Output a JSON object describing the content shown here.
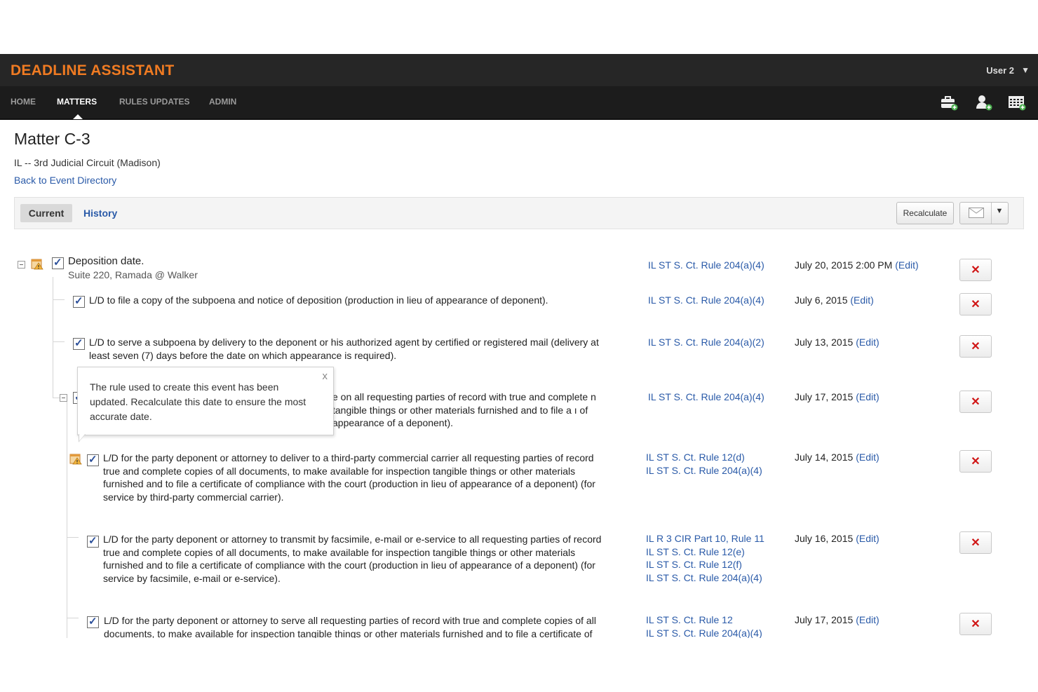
{
  "header": {
    "brand": "DEADLINE ASSISTANT",
    "user": "User 2",
    "nav": [
      "HOME",
      "MATTERS",
      "RULES UPDATES",
      "ADMIN"
    ],
    "tools": [
      "add-matter-icon",
      "add-user-icon",
      "add-calendar-icon"
    ]
  },
  "page": {
    "title": "Matter C-3",
    "court": "IL -- 3rd Judicial Circuit (Madison)",
    "back_link": "Back to Event Directory"
  },
  "tabs": {
    "current": "Current",
    "history": "History"
  },
  "toolbar": {
    "recalculate": "Recalculate"
  },
  "tooltip": {
    "text": "The rule used to create this event has been updated. Recalculate this date to ensure the most accurate date.",
    "close": "x"
  },
  "events": [
    {
      "title": "Deposition date.",
      "subtitle": "Suite 220, Ramada @ Walker",
      "rules": [
        "IL ST S. Ct. Rule 204(a)(4)"
      ],
      "date": "July 20, 2015 2:00 PM",
      "edit": "(Edit)"
    },
    {
      "text": "L/D to file a copy of the subpoena and notice of deposition (production in lieu of appearance of deponent).",
      "rules": [
        "IL ST S. Ct. Rule 204(a)(4)"
      ],
      "date": "July 6, 2015",
      "edit": "(Edit)"
    },
    {
      "text": "L/D to serve a subpoena by delivery to the deponent or his authorized agent by certified or registered mail (delivery at least seven (7) days before the date on which appearance is required).",
      "rules": [
        "IL ST S. Ct. Rule 204(a)(2)"
      ],
      "date": "July 13, 2015",
      "edit": "(Edit)"
    },
    {
      "text": "e on all requesting parties of record with true and complete n tangible things or other materials furnished and to file a ı of appearance of a deponent).",
      "rules": [
        "IL ST S. Ct. Rule 204(a)(4)"
      ],
      "date": "July 17, 2015",
      "edit": "(Edit)"
    },
    {
      "text": "L/D for the party deponent or attorney to deliver to a third-party commercial carrier all requesting parties of record true and complete copies of all documents, to make available for inspection tangible things or other materials furnished and to file a certificate of compliance with the court (production in lieu of appearance of a deponent) (for service by third-party commercial carrier).",
      "rules": [
        "IL ST S. Ct. Rule 12(d)",
        "IL ST S. Ct. Rule 204(a)(4)"
      ],
      "date": "July 14, 2015",
      "edit": "(Edit)"
    },
    {
      "text": "L/D for the party deponent or attorney to transmit by facsimile, e-mail or e-service to all requesting parties of record true and complete copies of all documents, to make available for inspection tangible things or other materials furnished and to file a certificate of compliance with the court (production in lieu of appearance of a deponent) (for service by facsimile, e-mail or e-service).",
      "rules": [
        "IL R 3 CIR Part 10, Rule 11",
        "IL ST S. Ct. Rule 12(e)",
        "IL ST S. Ct. Rule 12(f)",
        "IL ST S. Ct. Rule 204(a)(4)"
      ],
      "date": "July 16, 2015",
      "edit": "(Edit)"
    },
    {
      "text": "L/D for the party deponent or attorney to serve all requesting parties of record with true and complete copies of all documents, to make available for inspection tangible things or other materials furnished and to file a certificate of",
      "rules": [
        "IL ST S. Ct. Rule 12",
        "IL ST S. Ct. Rule 204(a)(4)"
      ],
      "date": "July 17, 2015",
      "edit": "(Edit)"
    }
  ],
  "colors": {
    "brand": "#f07b22",
    "link": "#2a5aa8",
    "delete": "#d01515",
    "header_bg": "#262626"
  }
}
